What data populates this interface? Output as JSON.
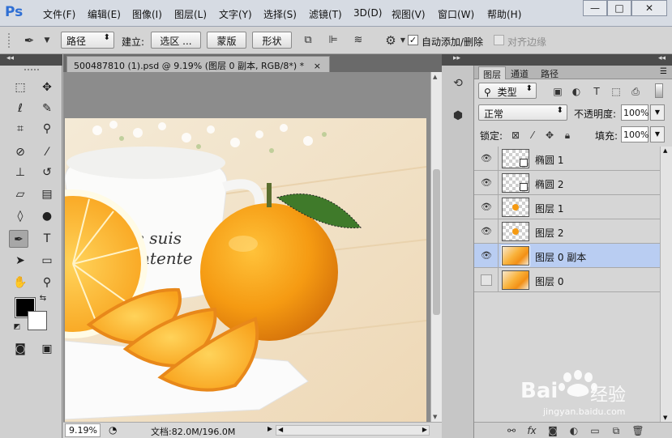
{
  "app": {
    "logo": "Ps"
  },
  "menu": [
    "文件(F)",
    "编辑(E)",
    "图像(I)",
    "图层(L)",
    "文字(Y)",
    "选择(S)",
    "滤镜(T)",
    "3D(D)",
    "视图(V)",
    "窗口(W)",
    "帮助(H)"
  ],
  "window_controls": {
    "minimize": "—",
    "maximize": "□",
    "close": "✕"
  },
  "options": {
    "mode": "路径",
    "make_label": "建立:",
    "selection_btn": "选区 ...",
    "mask_btn": "蒙版",
    "shape_btn": "形状",
    "auto_add_label": "自动添加/删除",
    "auto_add_checked": true,
    "align_edges_label": "对齐边缘",
    "align_edges_checked": false
  },
  "document": {
    "tab_title": "500487810 (1).psd @ 9.19% (图层 0 副本, RGB/8*) *",
    "tab_close": "×",
    "zoom": "9.19%",
    "doc_info": "文档:82.0M/196.0M",
    "photo_text_line1": "Je suis",
    "photo_text_line2": "ontente"
  },
  "layers_panel": {
    "tabs": [
      "图层",
      "通道",
      "路径"
    ],
    "active_tab": 0,
    "filter_kind": "类型",
    "blend_mode": "正常",
    "opacity_label": "不透明度:",
    "opacity_value": "100%",
    "lock_label": "锁定:",
    "fill_label": "填充:",
    "fill_value": "100%",
    "layers": [
      {
        "name": "椭圆 1",
        "visible": true,
        "selected": false,
        "thumb": "shape"
      },
      {
        "name": "椭圆 2",
        "visible": true,
        "selected": false,
        "thumb": "shape"
      },
      {
        "name": "图层 1",
        "visible": true,
        "selected": false,
        "thumb": "dot"
      },
      {
        "name": "图层 2",
        "visible": true,
        "selected": false,
        "thumb": "dot"
      },
      {
        "name": "图层 0 副本",
        "visible": true,
        "selected": true,
        "thumb": "photo"
      },
      {
        "name": "图层 0",
        "visible": false,
        "selected": false,
        "thumb": "photo"
      }
    ]
  },
  "watermark": {
    "brand": "Bai",
    "brand_cn": "经验",
    "url": "jingyan.baidu.com"
  },
  "colors": {
    "selected_layer": "#b9cdf2",
    "foreground": "#000000",
    "background": "#ffffff",
    "ps_blue": "#2f6fd4"
  }
}
